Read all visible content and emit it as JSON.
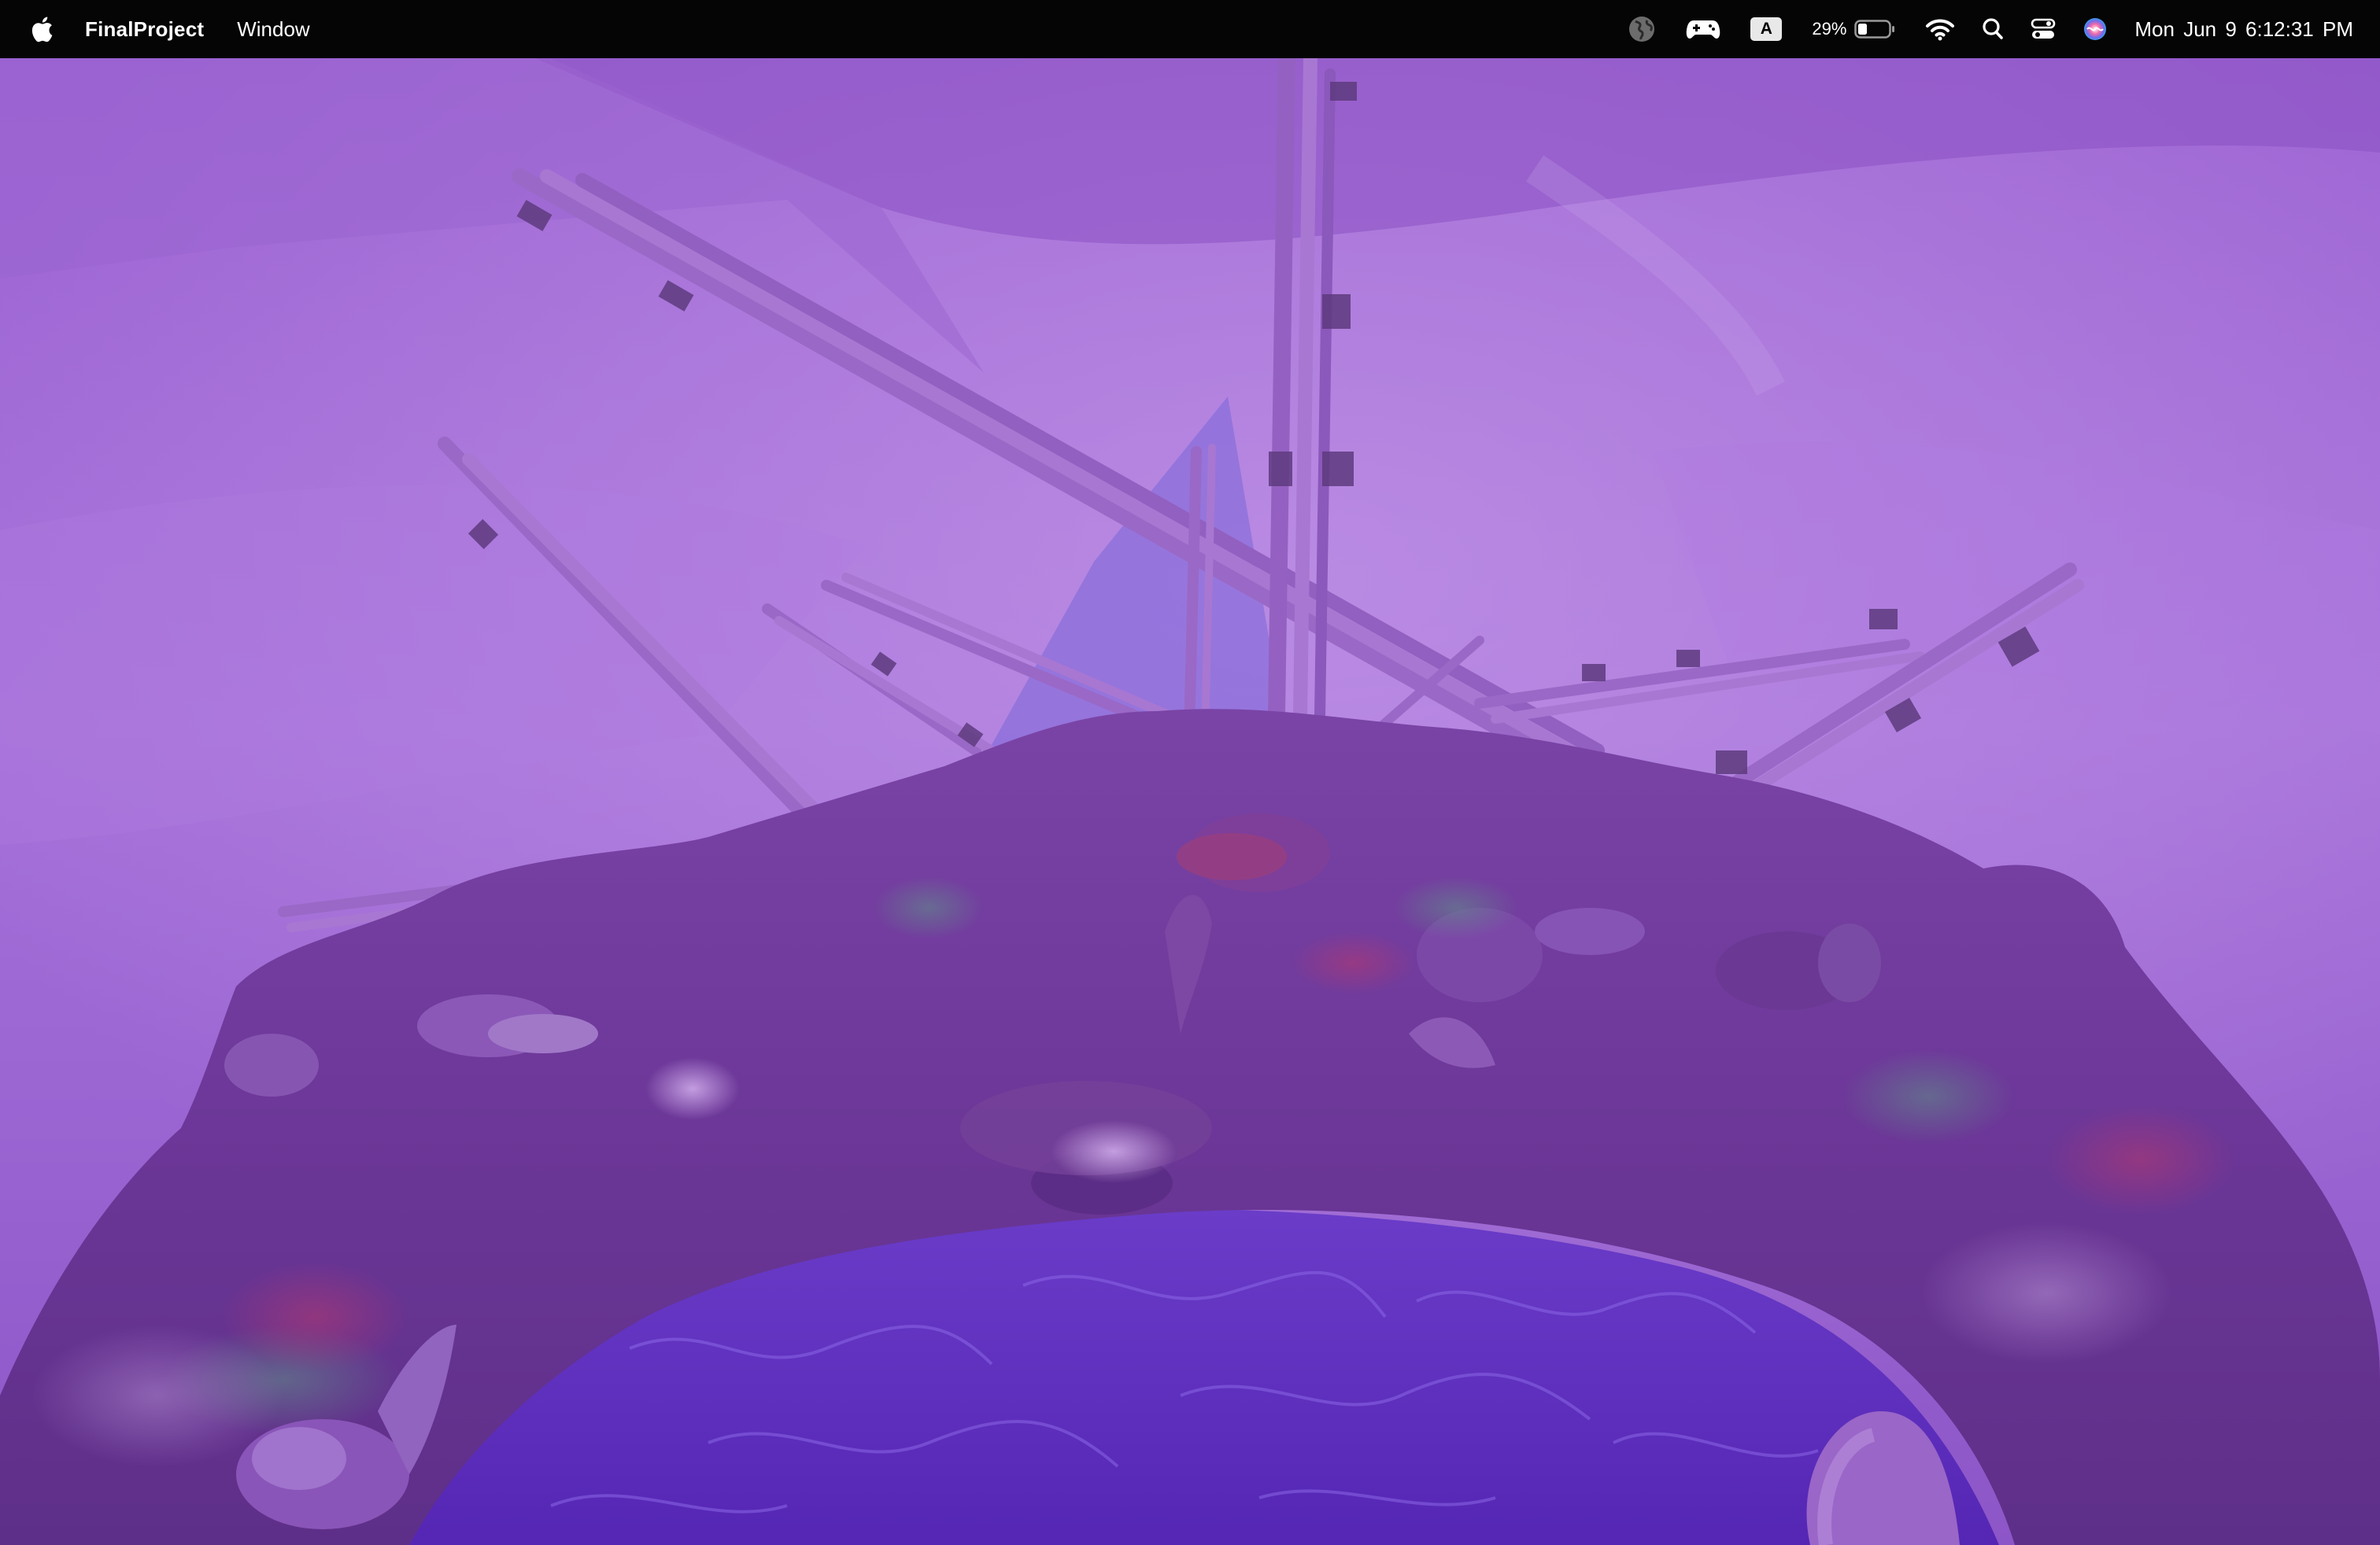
{
  "menubar": {
    "app_name": "FinalProject",
    "menus": [
      "Window"
    ],
    "input_source": "A",
    "battery_percent": "29%",
    "battery_level": 0.29,
    "clock": "Mon Jun 9  6:12:31 PM",
    "icons": [
      "apple-icon",
      "globe-icon",
      "game-controller-icon",
      "input-source-icon",
      "battery-icon",
      "wifi-icon",
      "search-icon",
      "control-center-icon",
      "siri-icon"
    ]
  },
  "scene": {
    "description_colors": {
      "sky": "#8a4fc4",
      "sky_light": "#b47fe0",
      "rock": "#6d3796",
      "water": "#5a2fb8",
      "sticks": "#9c6ac6"
    }
  }
}
